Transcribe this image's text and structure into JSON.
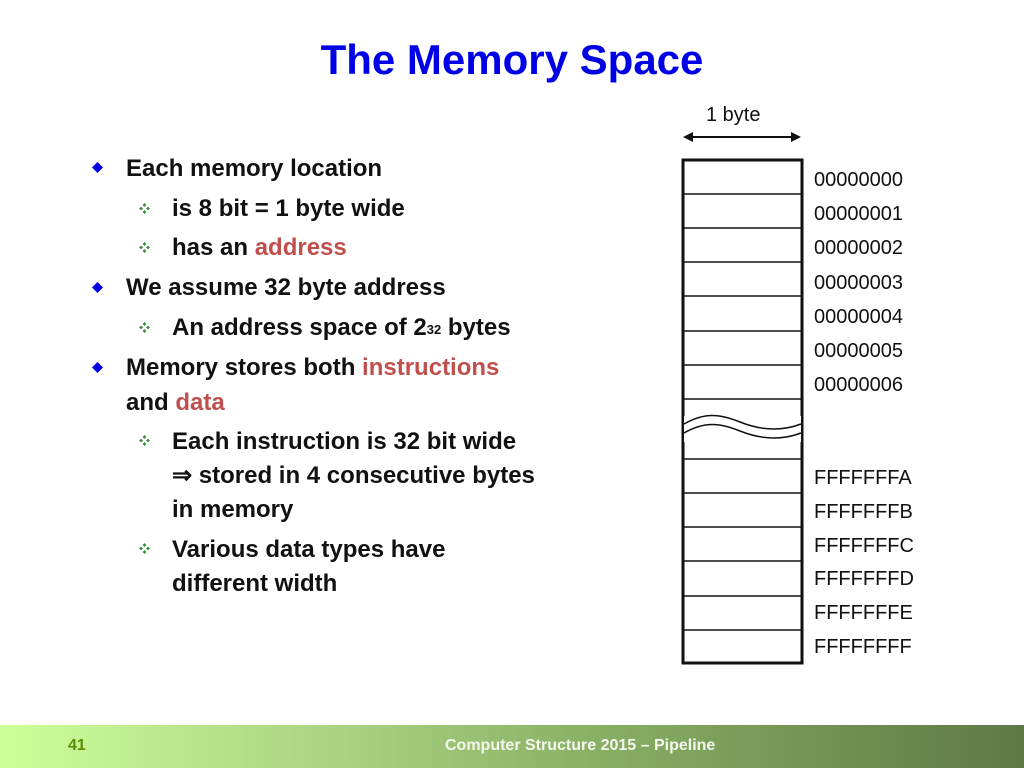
{
  "slide": {
    "title": "The Memory Space",
    "page_number": "41",
    "footer": "Computer Structure 2015 – Pipeline"
  },
  "colors": {
    "title": "#0000e6",
    "highlight": "#c0504d",
    "bullet_level1": "#0000e6",
    "bullet_level2": "#2e8b2e",
    "footer_start": "#ccff99",
    "footer_end": "#5e7a44"
  },
  "bullets": [
    {
      "level": 1,
      "icon": "diamond-bullet-icon",
      "text": "Each memory location"
    },
    {
      "level": 2,
      "icon": "four-diamond-bullet-icon",
      "text": "is 8 bit = 1 byte wide"
    },
    {
      "level": 2,
      "icon": "four-diamond-bullet-icon",
      "pre": "has an ",
      "highlight": "address"
    },
    {
      "level": 1,
      "icon": "diamond-bullet-icon",
      "text": "We assume 32 byte address"
    },
    {
      "level": 2,
      "icon": "four-diamond-bullet-icon",
      "pre": "An address space of 2",
      "sup": "32",
      "post": " bytes"
    },
    {
      "level": 1,
      "icon": "diamond-bullet-icon",
      "pre": "Memory stores both ",
      "highlight": "instructions",
      "line2_pre": "and ",
      "line2_highlight": "data"
    },
    {
      "level": 2,
      "icon": "four-diamond-bullet-icon",
      "text": "Each instruction is 32 bit wide",
      "line2": "⇒ stored in 4 consecutive bytes",
      "line3": "in memory"
    },
    {
      "level": 2,
      "icon": "four-diamond-bullet-icon",
      "text": "Various data types have",
      "line2": "different width"
    }
  ],
  "diagram": {
    "width_label": "1 byte",
    "width_arrow_icon": "double-arrow-icon",
    "break_icon": "wavy-break-icon",
    "addresses_low": [
      "00000000",
      "00000001",
      "00000002",
      "00000003",
      "00000004",
      "00000005",
      "00000006"
    ],
    "addresses_high": [
      "FFFFFFFA",
      "FFFFFFFB",
      "FFFFFFFC",
      "FFFFFFFD",
      "FFFFFFFE",
      "FFFFFFFF"
    ]
  }
}
